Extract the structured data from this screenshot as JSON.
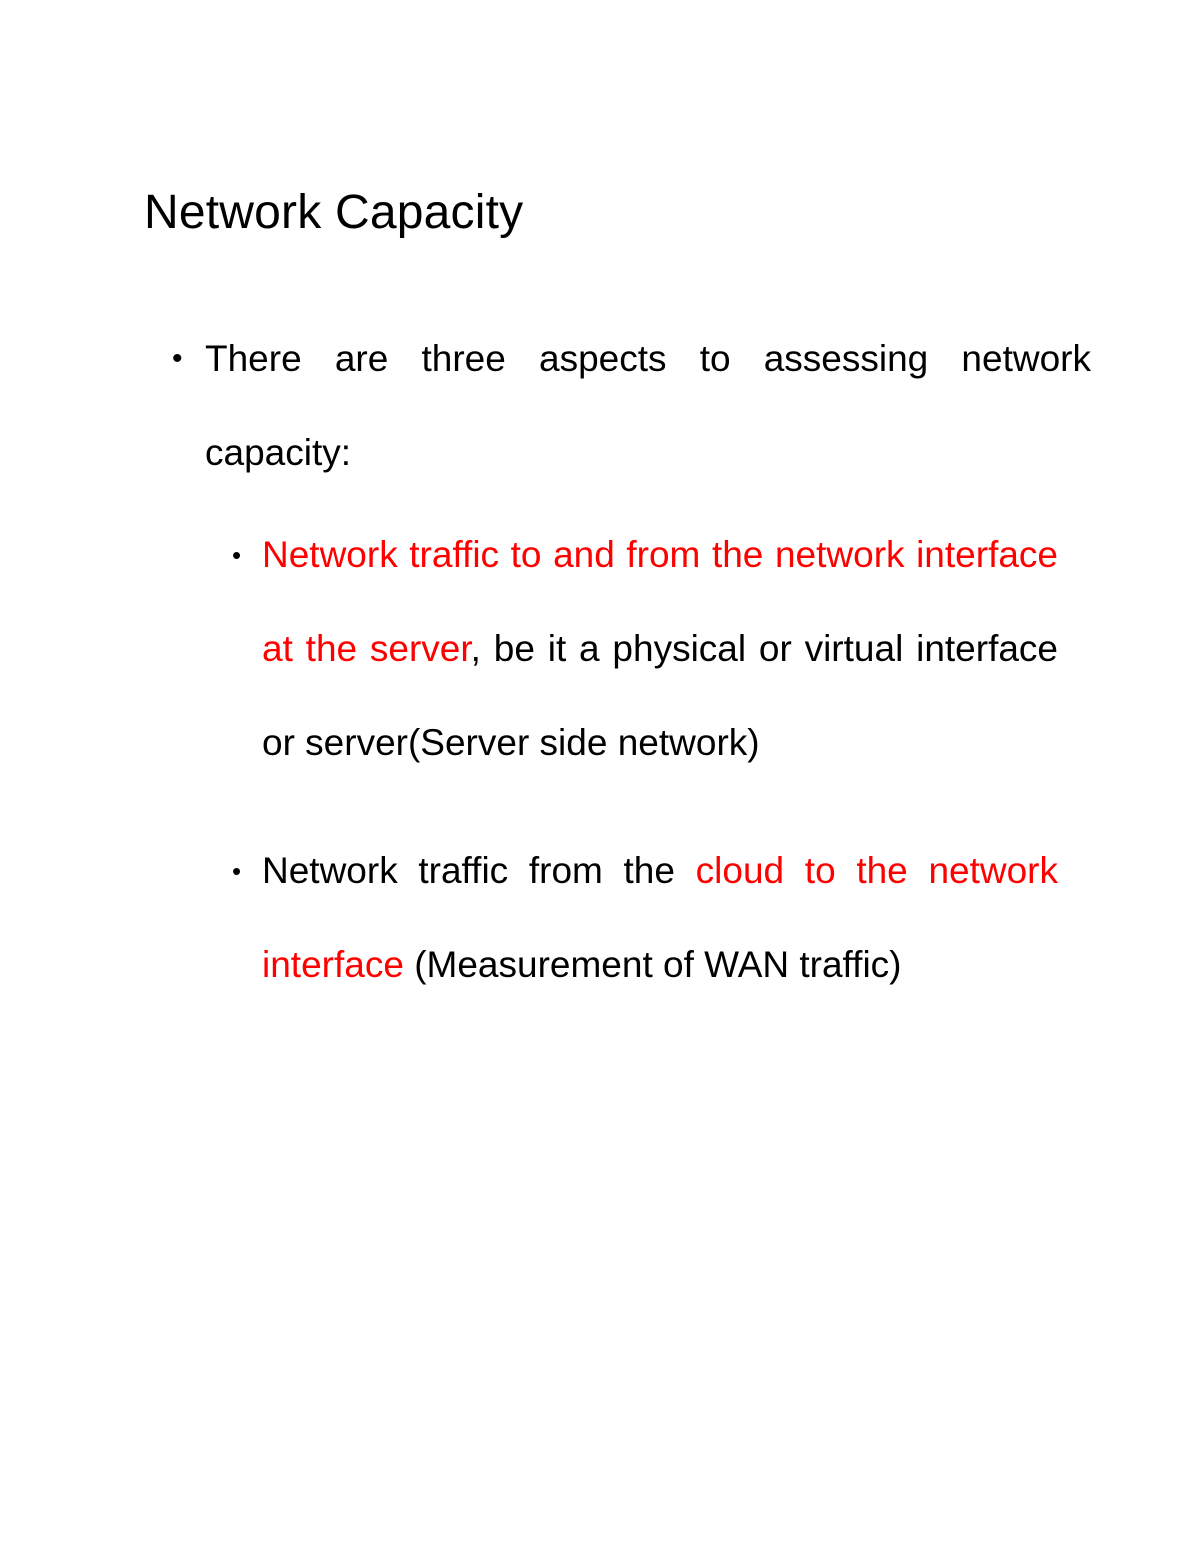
{
  "document": {
    "title": "Network Capacity",
    "colors": {
      "text": "#000000",
      "highlight": "#FF0000",
      "background": "#FFFFFF"
    },
    "bullet_glyph": "•"
  },
  "content": {
    "level1": [
      {
        "text": "There are three aspects to assessing network capacity:",
        "sub_bullets": [
          {
            "segments": [
              {
                "text": "Network traffic to and from the network interface at the server",
                "color": "red"
              },
              {
                "text": ", be it a physical or virtual interface or server(Server side network)",
                "color": "black"
              }
            ],
            "plain_text": "Network traffic to and from the network interface at the server, be it a physical or virtual interface or server(Server side network)"
          },
          {
            "segments": [
              {
                "text": "Network traffic from the ",
                "color": "black"
              },
              {
                "text": "cloud to the network interface",
                "color": "red"
              },
              {
                "text": " (Measurement of WAN traffic)",
                "color": "black"
              }
            ],
            "plain_text": "Network traffic from the cloud to the network interface (Measurement of WAN traffic)"
          }
        ]
      }
    ]
  }
}
